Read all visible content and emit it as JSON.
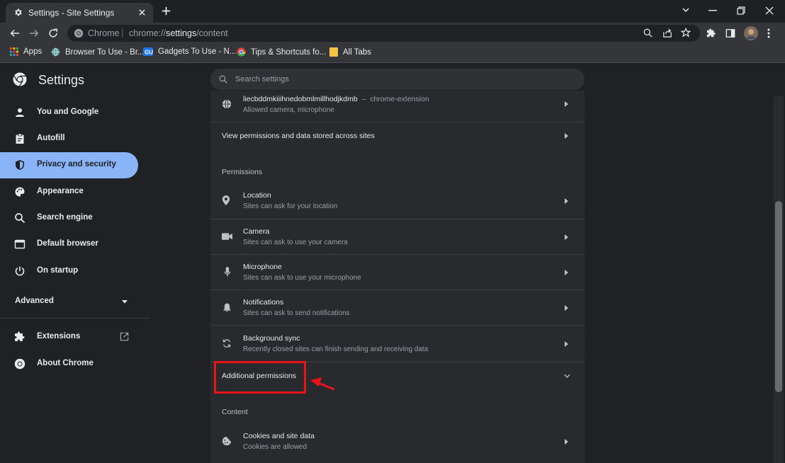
{
  "browser": {
    "tab_title": "Settings - Site Settings",
    "omnibox_site": "Chrome",
    "omnibox_url_scheme": "chrome://",
    "omnibox_url_host": "settings",
    "omnibox_url_path": "/content"
  },
  "bookmarks": [
    {
      "label": "Apps",
      "icon": "apps-grid-icon"
    },
    {
      "label": "Browser To Use - Br...",
      "icon": "globe-icon"
    },
    {
      "label": "Gadgets To Use - N...",
      "icon": "gadgets-icon"
    },
    {
      "label": "Tips & Shortcuts fo...",
      "icon": "chrome-icon"
    },
    {
      "label": "All Tabs",
      "icon": "folder-icon"
    }
  ],
  "settings": {
    "title": "Settings",
    "search_placeholder": "Search settings"
  },
  "sidebar": {
    "items": [
      {
        "label": "You and Google",
        "icon": "person-icon"
      },
      {
        "label": "Autofill",
        "icon": "clipboard-icon"
      },
      {
        "label": "Privacy and security",
        "icon": "shield-icon",
        "active": true
      },
      {
        "label": "Appearance",
        "icon": "palette-icon"
      },
      {
        "label": "Search engine",
        "icon": "search-icon"
      },
      {
        "label": "Default browser",
        "icon": "browser-window-icon"
      },
      {
        "label": "On startup",
        "icon": "power-icon"
      }
    ],
    "advanced": "Advanced",
    "extensions": "Extensions",
    "about": "About Chrome"
  },
  "main": {
    "extension_row": {
      "title": "liecbddmkiiihnedobmlmillhodjkdmb",
      "dash": "–",
      "tag": "chrome-extension",
      "subtitle": "Allowed camera, microphone"
    },
    "view_permissions": "View permissions and data stored across sites",
    "permissions_header": "Permissions",
    "permissions": [
      {
        "title": "Location",
        "subtitle": "Sites can ask for your location",
        "icon": "location-pin-icon"
      },
      {
        "title": "Camera",
        "subtitle": "Sites can ask to use your camera",
        "icon": "camera-icon"
      },
      {
        "title": "Microphone",
        "subtitle": "Sites can ask to use your microphone",
        "icon": "microphone-icon"
      },
      {
        "title": "Notifications",
        "subtitle": "Sites can ask to send notifications",
        "icon": "bell-icon"
      },
      {
        "title": "Background sync",
        "subtitle": "Recently closed sites can finish sending and receiving data",
        "icon": "sync-icon"
      }
    ],
    "additional_permissions": "Additional permissions",
    "content_header": "Content",
    "cookies": {
      "title": "Cookies and site data",
      "subtitle": "Cookies are allowed",
      "icon": "cookie-icon"
    }
  },
  "colors": {
    "accent": "#8ab4f8",
    "highlight": "#e8141a",
    "background": "#202124",
    "card": "#292a2d"
  }
}
